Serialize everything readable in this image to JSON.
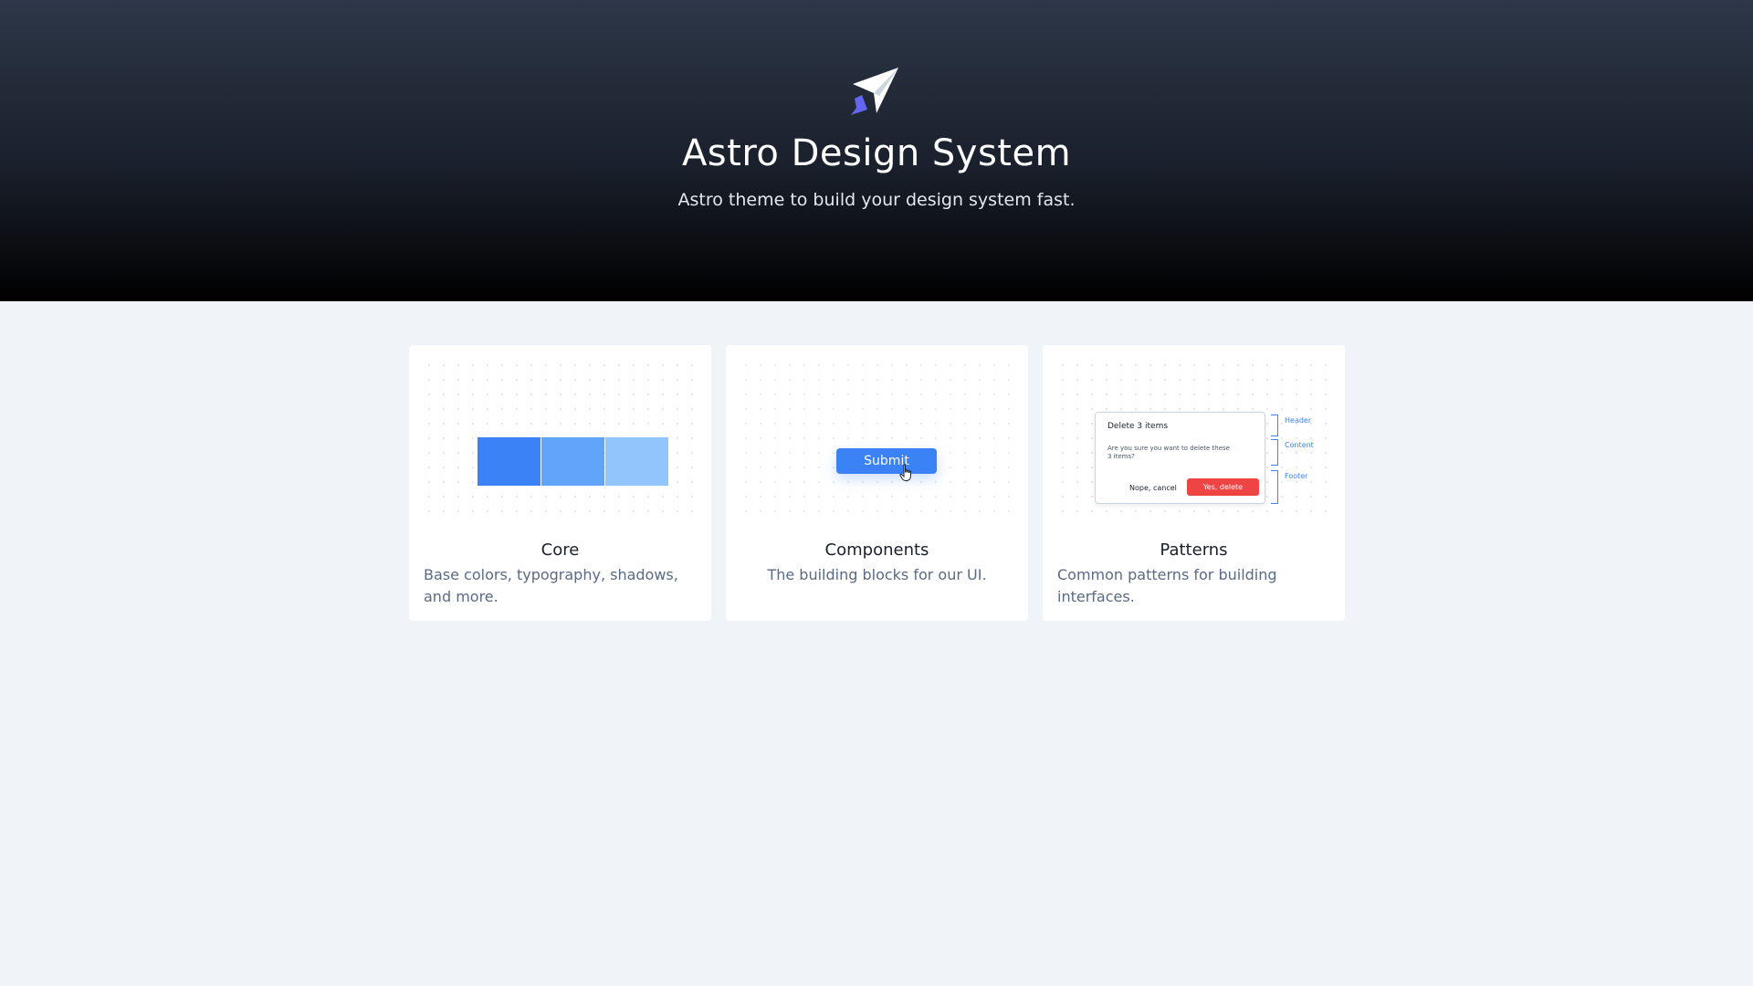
{
  "hero": {
    "title": "Astro Design System",
    "subtitle": "Astro theme to build your design system fast.",
    "logo_icon": "paper-plane-logo-icon",
    "gradient_colors": [
      "#2d3748",
      "#000000"
    ]
  },
  "cards": [
    {
      "title": "Core",
      "description": "Base colors, typography, shadows, and more.",
      "preview": {
        "swatches": [
          "#3b82f6",
          "#60a5fa",
          "#93c5fd"
        ]
      }
    },
    {
      "title": "Components",
      "description": "The building blocks for our UI.",
      "preview": {
        "button_label": "Submit",
        "button_color": "#3b82f6",
        "cursor_icon": "hand-pointer-icon"
      }
    },
    {
      "title": "Patterns",
      "description": "Common patterns for building interfaces.",
      "preview": {
        "dialog_title": "Delete 3 items",
        "dialog_body": "Are you sure you want to delete these 3 items?",
        "cancel_label": "Nope, cancel",
        "confirm_label": "Yes, delete",
        "confirm_color": "#ef4444",
        "annotation_color": "#3b82f6",
        "annotations": [
          "Header",
          "Content",
          "Footer"
        ]
      }
    }
  ]
}
